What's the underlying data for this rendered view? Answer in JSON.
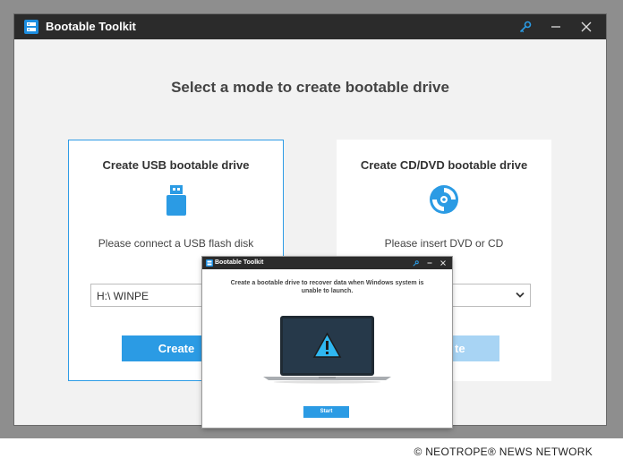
{
  "app": {
    "title": "Bootable Toolkit"
  },
  "main": {
    "heading": "Select a mode to create bootable drive"
  },
  "usb_card": {
    "title": "Create USB bootable drive",
    "icon": "usb-drive-icon",
    "message": "Please connect a USB flash disk",
    "selected_drive": "H:\\ WINPE",
    "button_label": "Create"
  },
  "cd_card": {
    "title": "Create CD/DVD bootable drive",
    "icon": "disc-icon",
    "message": "Please insert DVD or CD",
    "button_label_visible": "te"
  },
  "overlay_window": {
    "title": "Bootable Toolkit",
    "message": "Create a bootable drive to recover data when Windows system is unable to launch.",
    "illustration": "laptop-warning-icon",
    "start_label": "Start"
  },
  "footer": {
    "credit": "© NEOTROPE® NEWS NETWORK"
  },
  "colors": {
    "accent": "#2b9be4",
    "titlebar": "#2b2b2b",
    "disabled_button": "#a8d4f4"
  }
}
